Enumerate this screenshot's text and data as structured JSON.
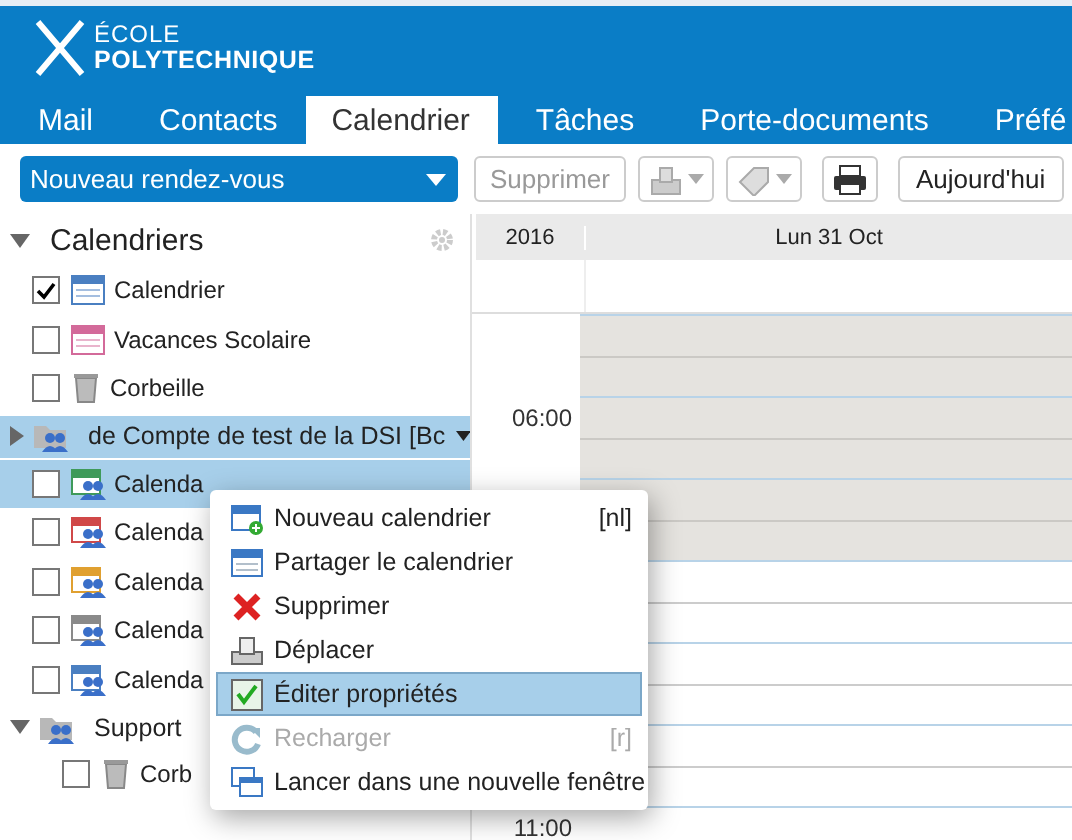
{
  "logo": {
    "line_1": "ÉCOLE",
    "line_2": "POLYTECHNIQUE"
  },
  "tabs": [
    {
      "label": "Mail",
      "selected": false
    },
    {
      "label": "Contacts",
      "selected": false
    },
    {
      "label": "Calendrier",
      "selected": true
    },
    {
      "label": "Tâches",
      "selected": false
    },
    {
      "label": "Porte-documents",
      "selected": false
    },
    {
      "label": "Préfé",
      "selected": false
    }
  ],
  "toolbar": {
    "new_button": "Nouveau rendez-vous",
    "delete_button": {
      "label": "Supprimer",
      "disabled": true
    },
    "today_button": "Aujourd'hui"
  },
  "sidebar": {
    "title": "Calendriers",
    "expanded": true,
    "items": [
      {
        "label": "Calendrier",
        "checked": true,
        "kind": "calendar",
        "color": "#4a7fc1"
      },
      {
        "label": "Vacances Scolaire",
        "checked": false,
        "kind": "calendar",
        "color": "#d36a9a"
      },
      {
        "label": "Corbeille",
        "checked": false,
        "kind": "trash"
      }
    ],
    "groups": [
      {
        "label": "de Compte de test de la DSI [Bc",
        "expanded": false,
        "selected": true,
        "children": [
          {
            "label": "Calenda",
            "checked": false,
            "kind": "shared",
            "color": "#3f9a5a",
            "selected": true
          },
          {
            "label": "Calenda",
            "checked": false,
            "kind": "shared",
            "color": "#d04848",
            "selected": false
          },
          {
            "label": "Calenda",
            "checked": false,
            "kind": "shared",
            "color": "#e0a030",
            "selected": false
          },
          {
            "label": "Calenda",
            "checked": false,
            "kind": "shared",
            "color": "#8a8a8a",
            "selected": false
          },
          {
            "label": "Calenda",
            "checked": false,
            "kind": "shared",
            "color": "#4a7fc1",
            "selected": false
          }
        ]
      },
      {
        "label": "Support",
        "expanded": true,
        "selected": false,
        "children": [
          {
            "label": "Corb",
            "checked": false,
            "kind": "trash",
            "selected": false
          }
        ]
      }
    ]
  },
  "calendar": {
    "year": "2016",
    "day": "Lun 31 Oct",
    "slots": [
      {
        "working": false
      },
      {
        "time": "06:00",
        "working": false
      },
      {
        "working": false
      },
      {
        "working": true
      },
      {
        "working": true
      },
      {
        "working": true
      },
      {
        "time": "11:00",
        "working": true
      }
    ]
  },
  "context_menu": [
    {
      "label": "Nouveau calendrier",
      "shortcut": "[nl]",
      "selected": false,
      "disabled": false
    },
    {
      "label": "Partager le calendrier",
      "selected": false,
      "disabled": false
    },
    {
      "label": "Supprimer",
      "selected": false,
      "disabled": false
    },
    {
      "label": "Déplacer",
      "selected": false,
      "disabled": false
    },
    {
      "label": "Éditer propriétés",
      "selected": true,
      "disabled": false
    },
    {
      "label": "Recharger",
      "shortcut": "[r]",
      "selected": false,
      "disabled": true
    },
    {
      "label": "Lancer dans une nouvelle fenêtre",
      "selected": false,
      "disabled": false
    }
  ]
}
